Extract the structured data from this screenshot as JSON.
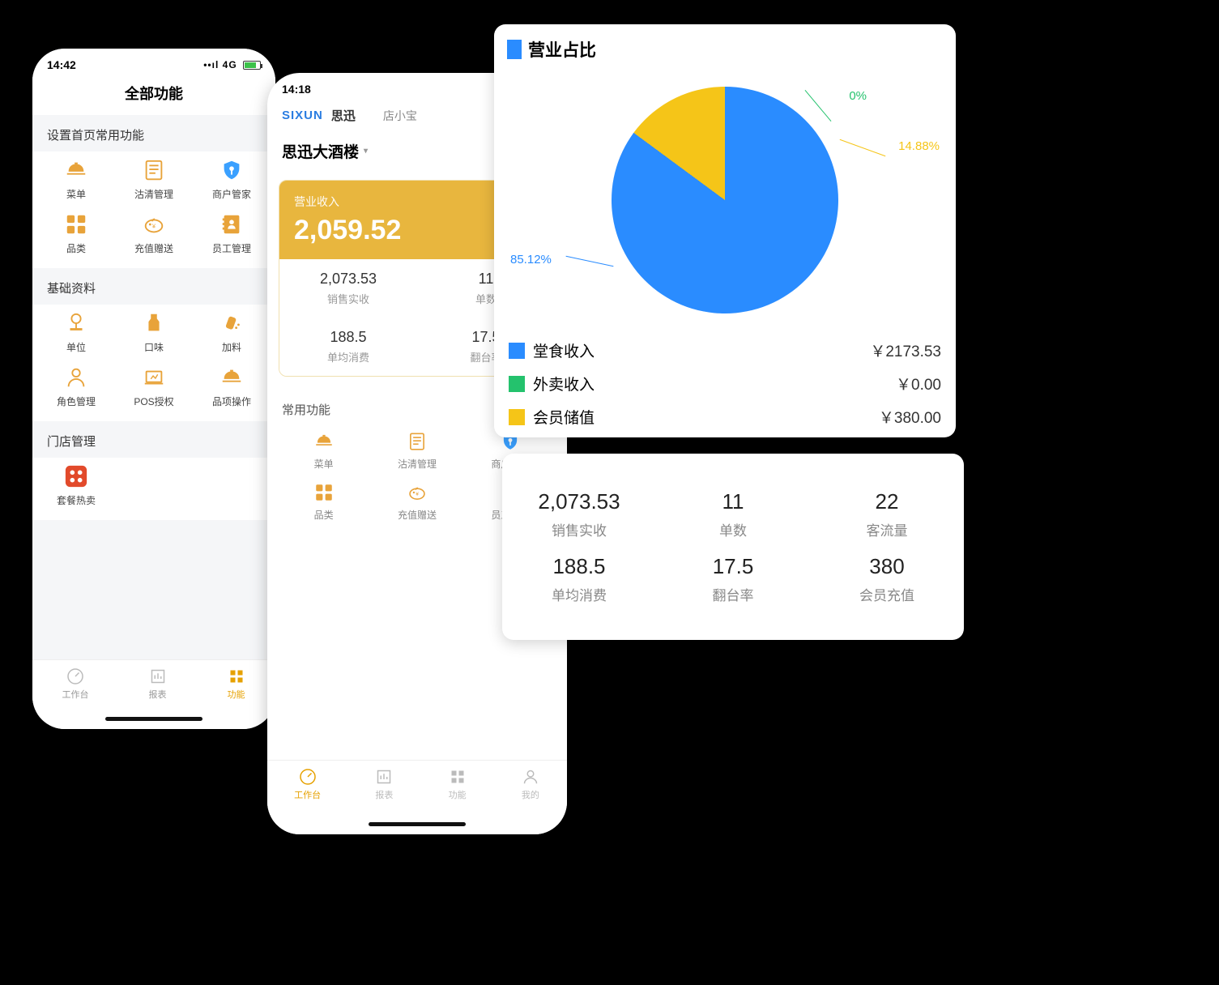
{
  "phoneA": {
    "time": "14:42",
    "net": "4G",
    "title": "全部功能",
    "section1": "设置首页常用功能",
    "section2": "基础资料",
    "section3": "门店管理",
    "items1": [
      {
        "icon": "cloche",
        "label": "菜单"
      },
      {
        "icon": "doc",
        "label": "沽清管理"
      },
      {
        "icon": "shield",
        "label": "商户管家"
      },
      {
        "icon": "grid",
        "label": "品类"
      },
      {
        "icon": "piggy",
        "label": "充值赠送"
      },
      {
        "icon": "book",
        "label": "员工管理"
      }
    ],
    "items2": [
      {
        "icon": "scale",
        "label": "单位"
      },
      {
        "icon": "bottle",
        "label": "口味"
      },
      {
        "icon": "shaker",
        "label": "加料"
      },
      {
        "icon": "person",
        "label": "角色管理"
      },
      {
        "icon": "laptop",
        "label": "POS授权"
      },
      {
        "icon": "cloche",
        "label": "品项操作"
      }
    ],
    "items3": [
      {
        "icon": "grid-red",
        "label": "套餐热卖"
      }
    ],
    "tabs": [
      {
        "icon": "gauge",
        "label": "工作台",
        "active": false
      },
      {
        "icon": "chart",
        "label": "报表",
        "active": false
      },
      {
        "icon": "grid",
        "label": "功能",
        "active": true
      }
    ]
  },
  "phoneB": {
    "time": "14:18",
    "brand1": "SIXUN",
    "brand2": "思迅",
    "brandSub": "店小宝",
    "store": "思迅大酒楼",
    "revLabel": "营业收入",
    "revValue": "2,059.52",
    "cells": [
      {
        "v": "2,073.53",
        "l": "销售实收"
      },
      {
        "v": "11",
        "l": "单数"
      },
      {
        "v": "188.5",
        "l": "单均消费"
      },
      {
        "v": "17.5",
        "l": "翻台率"
      }
    ],
    "commonH": "常用功能",
    "items": [
      {
        "icon": "cloche",
        "label": "菜单"
      },
      {
        "icon": "doc",
        "label": "沽清管理"
      },
      {
        "icon": "shield",
        "label": "商户管家"
      },
      {
        "icon": "grid",
        "label": "品类"
      },
      {
        "icon": "piggy",
        "label": "充值赠送"
      },
      {
        "icon": "book",
        "label": "员工管理"
      }
    ],
    "tabs": [
      {
        "icon": "gauge",
        "label": "工作台",
        "active": true
      },
      {
        "icon": "chart",
        "label": "报表",
        "active": false
      },
      {
        "icon": "grid",
        "label": "功能",
        "active": false
      },
      {
        "icon": "user",
        "label": "我的",
        "active": false
      }
    ]
  },
  "pie": {
    "title": "营业占比",
    "labels": {
      "big": "85.12%",
      "mid": "14.88%",
      "small": "0%"
    },
    "rows": [
      {
        "color": "#2a8cff",
        "name": "堂食收入",
        "amt": "￥2173.53"
      },
      {
        "color": "#24c26d",
        "name": "外卖收入",
        "amt": "￥0.00"
      },
      {
        "color": "#f5c518",
        "name": "会员储值",
        "amt": "￥380.00"
      }
    ]
  },
  "chart_data": {
    "type": "pie",
    "title": "营业占比",
    "series": [
      {
        "name": "堂食收入",
        "value": 2173.53,
        "percent": 85.12,
        "color": "#2a8cff"
      },
      {
        "name": "外卖收入",
        "value": 0.0,
        "percent": 0,
        "color": "#24c26d"
      },
      {
        "name": "会员储值",
        "value": 380.0,
        "percent": 14.88,
        "color": "#f5c518"
      }
    ]
  },
  "stats": [
    {
      "v": "2,073.53",
      "l": "销售实收"
    },
    {
      "v": "11",
      "l": "单数"
    },
    {
      "v": "22",
      "l": "客流量"
    },
    {
      "v": "188.5",
      "l": "单均消费"
    },
    {
      "v": "17.5",
      "l": "翻台率"
    },
    {
      "v": "380",
      "l": "会员充值"
    }
  ]
}
